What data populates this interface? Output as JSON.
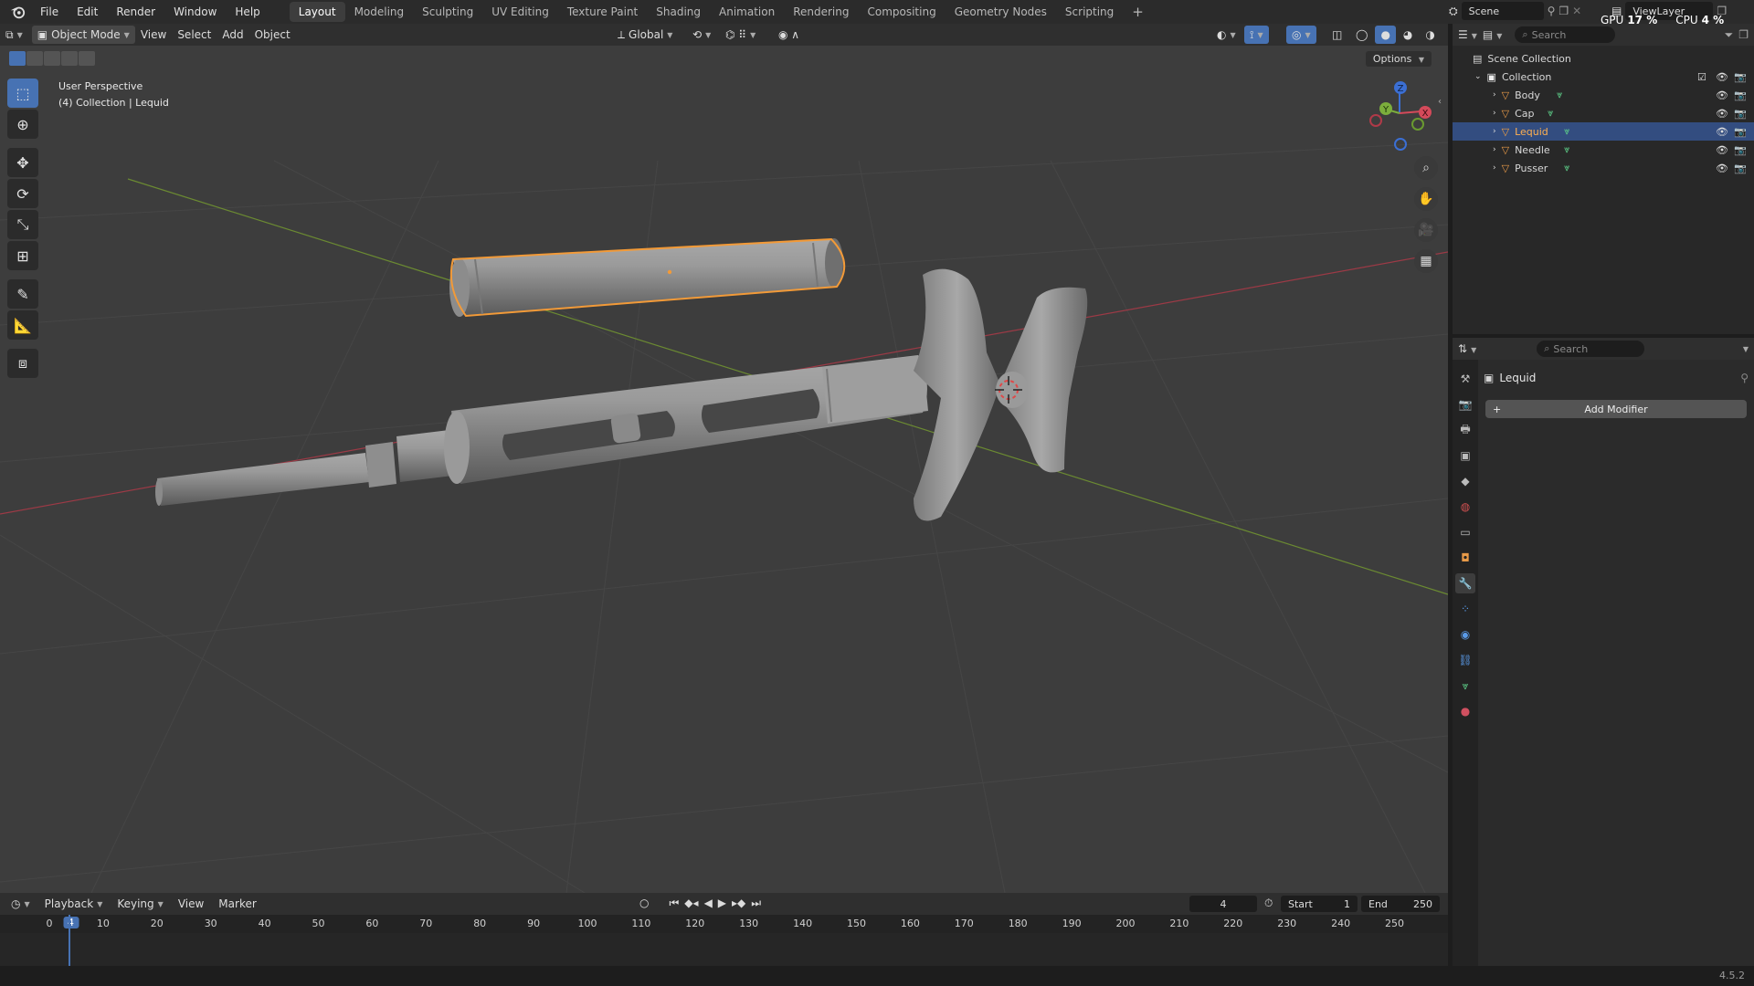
{
  "topbar": {
    "menus": [
      "File",
      "Edit",
      "Render",
      "Window",
      "Help"
    ],
    "workspaces": [
      "Layout",
      "Modeling",
      "Sculpting",
      "UV Editing",
      "Texture Paint",
      "Shading",
      "Animation",
      "Rendering",
      "Compositing",
      "Geometry Nodes",
      "Scripting"
    ],
    "active_workspace": "Layout",
    "add_tab": "+",
    "scene": "Scene",
    "view_layer": "ViewLayer",
    "gpu_label": "GPU",
    "gpu_value": "17 %",
    "cpu_label": "CPU",
    "cpu_value": "4 %"
  },
  "viewport": {
    "mode": "Object Mode",
    "menus": [
      "View",
      "Select",
      "Add",
      "Object"
    ],
    "orientation": "Global",
    "options": "Options",
    "info_line1": "User Perspective",
    "info_line2": "(4) Collection | Lequid"
  },
  "outliner": {
    "search_placeholder": "Search",
    "scene_collection": "Scene Collection",
    "collection": "Collection",
    "objects": [
      "Body",
      "Cap",
      "Lequid",
      "Needle",
      "Pusser"
    ],
    "selected_object": "Lequid"
  },
  "properties": {
    "search_placeholder": "Search",
    "object_name": "Lequid",
    "add_modifier": "Add Modifier"
  },
  "timeline": {
    "menus": [
      "Playback",
      "Keying",
      "View",
      "Marker"
    ],
    "current_frame": "4",
    "start_label": "Start",
    "start_value": "1",
    "end_label": "End",
    "end_value": "250",
    "ticks": [
      "0",
      "10",
      "20",
      "30",
      "40",
      "50",
      "60",
      "70",
      "80",
      "90",
      "100",
      "110",
      "120",
      "130",
      "140",
      "150",
      "160",
      "170",
      "180",
      "190",
      "200",
      "210",
      "220",
      "230",
      "240",
      "250"
    ]
  },
  "statusbar": {
    "version": "4.5.2"
  },
  "colors": {
    "accent": "#4772b3",
    "selection_outline": "#f29a38",
    "x_axis": "#c04050",
    "y_axis": "#7ea040"
  }
}
